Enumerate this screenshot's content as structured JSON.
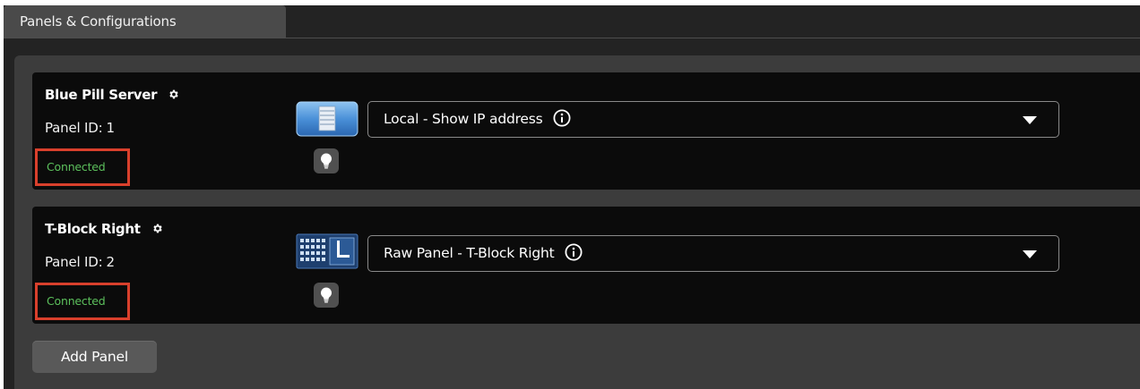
{
  "tab": {
    "label": "Panels & Configurations"
  },
  "panels": [
    {
      "name": "Blue Pill Server",
      "id_label": "Panel ID:",
      "id_value": "1",
      "status": "Connected",
      "status_color": "#5cc05c",
      "device_icon": "server-icon",
      "config": "Local - Show IP address"
    },
    {
      "name": "T-Block Right",
      "id_label": "Panel ID:",
      "id_value": "2",
      "status": "Connected",
      "status_color": "#5cc05c",
      "device_icon": "control-panel-icon",
      "config": "Raw Panel - T-Block Right"
    }
  ],
  "add_panel_label": "Add Panel",
  "colors": {
    "highlight_box": "#d9402c",
    "card_bg": "#0b0b0b",
    "area_bg": "#3c3c3c"
  }
}
